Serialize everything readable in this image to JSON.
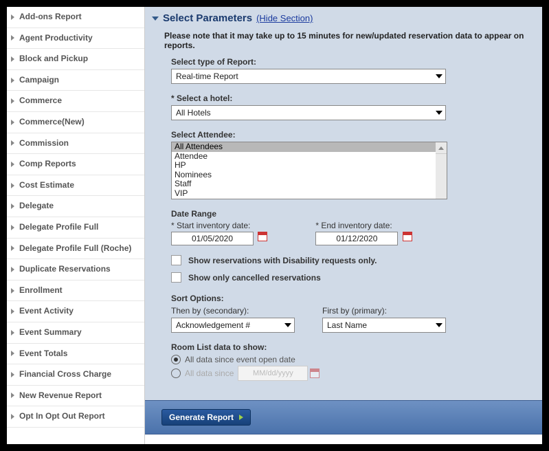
{
  "sidebar": {
    "items": [
      {
        "label": "Add-ons Report"
      },
      {
        "label": "Agent Productivity"
      },
      {
        "label": "Block and Pickup"
      },
      {
        "label": "Campaign"
      },
      {
        "label": "Commerce"
      },
      {
        "label": "Commerce(New)"
      },
      {
        "label": "Commission"
      },
      {
        "label": "Comp Reports"
      },
      {
        "label": "Cost Estimate"
      },
      {
        "label": "Delegate"
      },
      {
        "label": "Delegate Profile Full"
      },
      {
        "label": "Delegate Profile Full (Roche)"
      },
      {
        "label": "Duplicate Reservations"
      },
      {
        "label": "Enrollment"
      },
      {
        "label": "Event Activity"
      },
      {
        "label": "Event Summary"
      },
      {
        "label": "Event Totals"
      },
      {
        "label": "Financial Cross Charge"
      },
      {
        "label": "New Revenue Report"
      },
      {
        "label": "Opt In Opt Out Report"
      }
    ]
  },
  "header": {
    "title": "Select Parameters",
    "hide_link": "(Hide Section)"
  },
  "note": "Please note that it may take up to 15 minutes for new/updated reservation data to appear on reports.",
  "report_type": {
    "label": "Select type of Report:",
    "value": "Real-time Report"
  },
  "hotel": {
    "label": "* Select a hotel:",
    "value": "All Hotels"
  },
  "attendee": {
    "label": "Select Attendee:",
    "options": [
      "All Attendees",
      "Attendee",
      "HP",
      "Nominees",
      "Staff",
      "VIP"
    ],
    "selected": "All Attendees"
  },
  "date_range": {
    "label": "Date Range",
    "start_label": "* Start inventory date:",
    "start_value": "01/05/2020",
    "end_label": "* End inventory date:",
    "end_value": "01/12/2020"
  },
  "filters": {
    "disability": "Show reservations with Disability requests only.",
    "cancelled": "Show only cancelled reservations"
  },
  "sort": {
    "label": "Sort Options:",
    "secondary_label": "Then by (secondary):",
    "secondary_value": "Acknowledgement #",
    "primary_label": "First by (primary):",
    "primary_value": "Last Name"
  },
  "room_list": {
    "label": "Room List data to show:",
    "opt1": "All data since event open date",
    "opt2": "All data since",
    "date_placeholder": "MM/dd/yyyy"
  },
  "action": {
    "generate": "Generate Report"
  }
}
